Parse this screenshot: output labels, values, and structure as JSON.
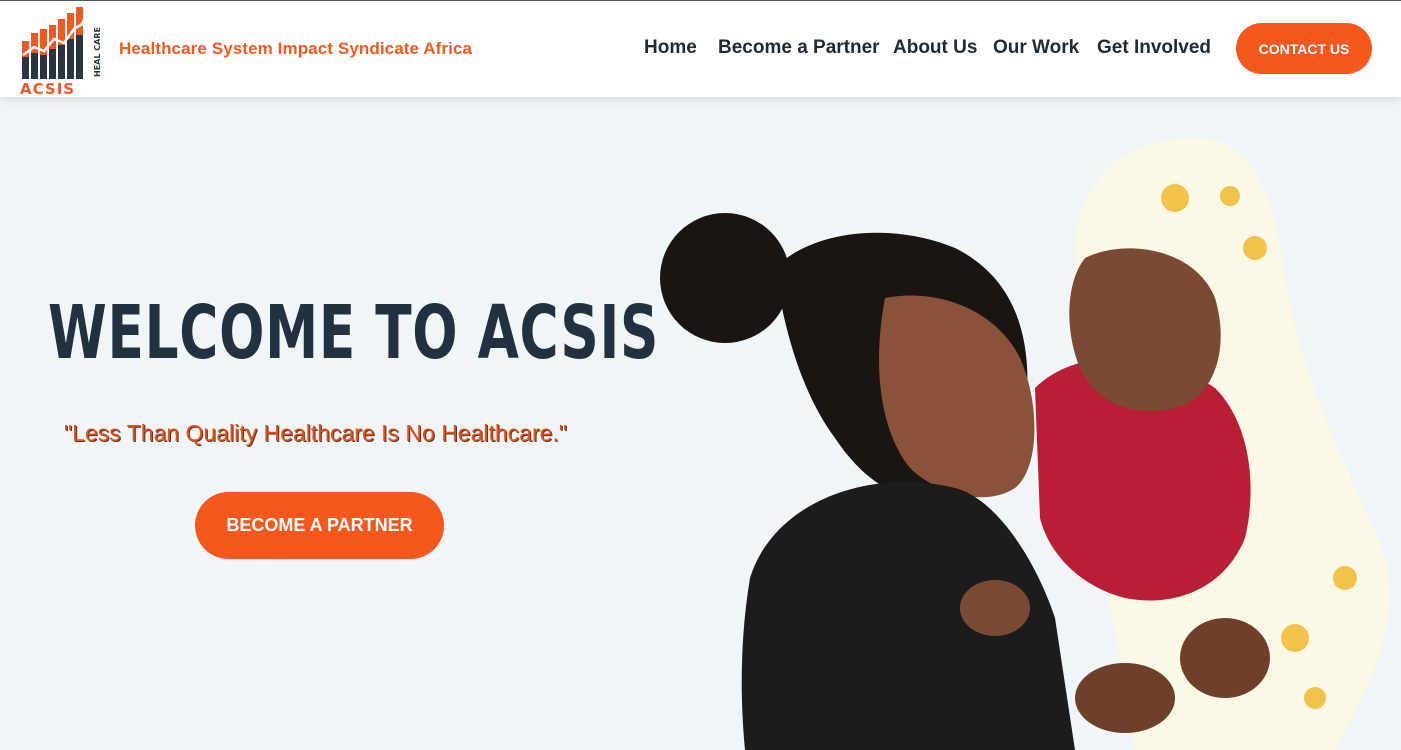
{
  "header": {
    "logo": {
      "word": "ACSIS",
      "side_text": "HEAL CARE",
      "icon": "bar-chart-growth-logo"
    },
    "tagline": "Healthcare System Impact Syndicate Africa",
    "nav": [
      {
        "label": "Home"
      },
      {
        "label": "Become a Partner"
      },
      {
        "label": "About Us"
      },
      {
        "label": "Our Work"
      },
      {
        "label": "Get Involved"
      }
    ],
    "cta_label": "CONTACT US"
  },
  "hero": {
    "title": "WELCOME TO ACSIS",
    "quote": "\"Less Than Quality Healthcare Is No Healthcare.\"",
    "button_label": "BECOME A PARTNER",
    "image": "mother-holding-baby-photo"
  },
  "colors": {
    "accent": "#f5571d",
    "dark_text": "#22313f",
    "background": "#f0f5f7"
  }
}
